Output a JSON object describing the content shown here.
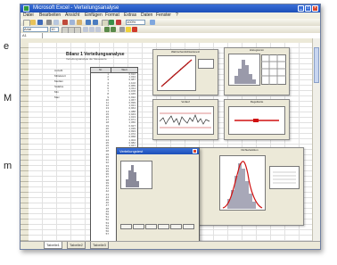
{
  "side_text": {
    "line1": "e",
    "line2": "M",
    "line3": "m"
  },
  "window": {
    "title": "Microsoft Excel - Verteilungsanalyse",
    "minimize_glyph": "_",
    "maximize_glyph": "□",
    "close_glyph": "×"
  },
  "menu": {
    "items": [
      "Datei",
      "Bearbeiten",
      "Ansicht",
      "Einfügen",
      "Format",
      "Extras",
      "Daten",
      "Fenster",
      "?"
    ]
  },
  "toolbar": {
    "font_name": "Arial",
    "font_size": "10",
    "zoom": "100%"
  },
  "formula": {
    "cell_ref": "A1"
  },
  "sheet": {
    "title": "Bilanz 1 Verteilungsanalyse",
    "subtitle": "Verteilungsanalyse der Messwerte",
    "stat_labels": [
      "Anzahl",
      "Mittelwert",
      "Median",
      "Stdabw.",
      "Min",
      "Max"
    ],
    "table_headers": [
      "Nr.",
      "Wert"
    ],
    "col_nr": [
      "1",
      "2",
      "3",
      "4",
      "5",
      "6",
      "7",
      "8",
      "9",
      "10",
      "11",
      "12",
      "13",
      "14",
      "15",
      "16",
      "17",
      "18",
      "19",
      "20",
      "21",
      "22",
      "23",
      "24",
      "25",
      "26",
      "27",
      "28",
      "29",
      "30",
      "31",
      "32",
      "33",
      "34",
      "35",
      "36",
      "37",
      "38",
      "39",
      "40",
      "41",
      "42",
      "43",
      "44",
      "45",
      "46",
      "47",
      "48",
      "49",
      "50",
      "51",
      "52",
      "53",
      "54",
      "55",
      "56",
      "57"
    ],
    "col_val": [
      "0,912",
      "1,034",
      "0,987",
      "1,102",
      "0,955",
      "1,011",
      "0,978",
      "1,045",
      "0,932",
      "1,067",
      "0,999",
      "1,021",
      "0,964",
      "1,088",
      "0,943",
      "1,013",
      "0,971",
      "1,056",
      "0,927",
      "1,039",
      "0,993",
      "1,072",
      "0,958",
      "1,004",
      "0,982",
      "1,047",
      "0,936",
      "1,091",
      "0,969",
      "1,017",
      "0,951",
      "1,063",
      "0,989",
      "1,028",
      "0,941",
      "1,081",
      "0,976",
      "1,009",
      "0,962",
      "1,052",
      "0,921",
      "1,036",
      "0,997",
      "1,077",
      "0,948",
      "1,024",
      "0,984",
      "1,058",
      "0,939",
      "1,095",
      "0,973",
      "1,015",
      "0,957",
      "1,069",
      "0,991",
      "1,031",
      "0,966"
    ]
  },
  "panels": {
    "p1_caption": "Wahrscheinlichkeitsnetz",
    "p2_caption": "Histogramm",
    "p3_caption": "Verlauf",
    "p4_caption": "Regelkarte",
    "p5_caption": "Dichtefunktion"
  },
  "dialog": {
    "title": "Verteilungstest"
  },
  "sheet_tabs": [
    "Tabelle1",
    "Tabelle2",
    "Tabelle3"
  ],
  "colors": {
    "accent": "#1c4fb8",
    "curve_red": "#d01010",
    "histogram_bar": "#a8a8b8"
  }
}
